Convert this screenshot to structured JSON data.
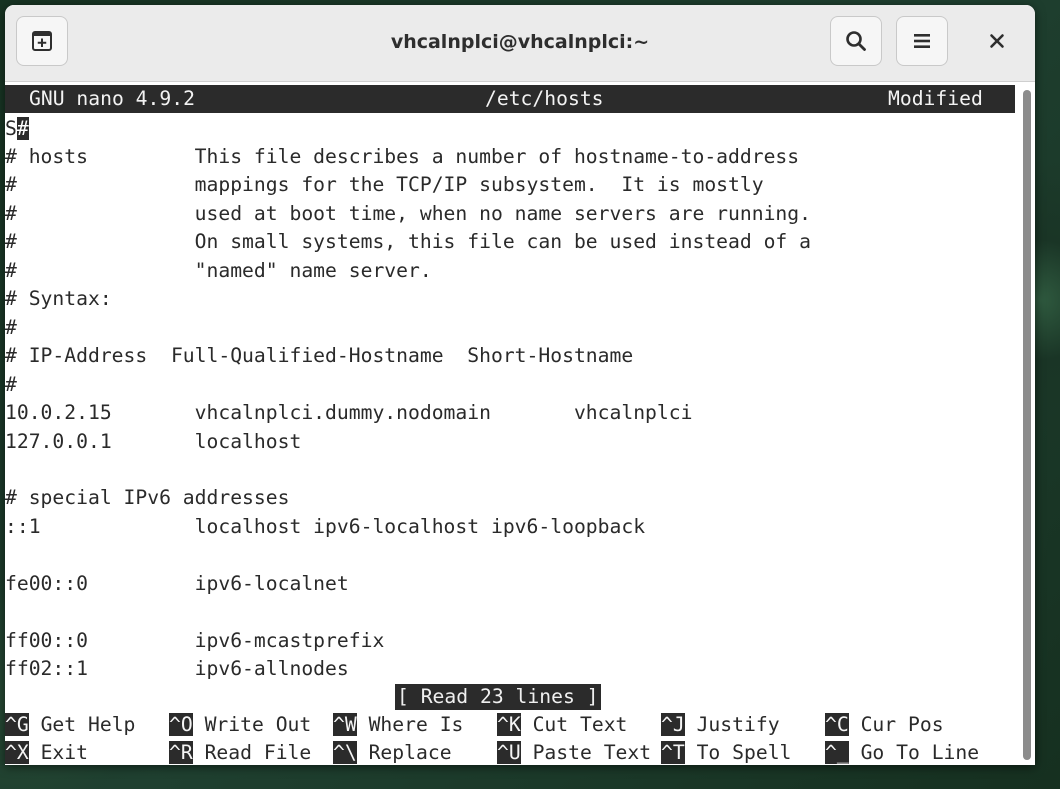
{
  "window": {
    "title": "vhcalnplci@vhcalnplci:~"
  },
  "icons": {
    "new_tab": "new-tab-icon",
    "search": "search-icon",
    "menu": "hamburger-menu-icon",
    "close": "close-icon"
  },
  "nano": {
    "header": {
      "app": "GNU nano 4.9.2",
      "filename": "/etc/hosts",
      "state": "Modified"
    },
    "cursor_line": {
      "prefix": "S",
      "cursor_char": "#"
    },
    "lines": [
      "# hosts         This file describes a number of hostname-to-address",
      "#               mappings for the TCP/IP subsystem.  It is mostly",
      "#               used at boot time, when no name servers are running.",
      "#               On small systems, this file can be used instead of a",
      "#               \"named\" name server.",
      "# Syntax:",
      "#",
      "# IP-Address  Full-Qualified-Hostname  Short-Hostname",
      "#",
      "10.0.2.15       vhcalnplci.dummy.nodomain       vhcalnplci",
      "127.0.0.1       localhost",
      "",
      "# special IPv6 addresses",
      "::1             localhost ipv6-localhost ipv6-loopback",
      "",
      "fe00::0         ipv6-localnet",
      "",
      "ff00::0         ipv6-mcastprefix",
      "ff02::1         ipv6-allnodes"
    ],
    "status": "[ Read 23 lines ]",
    "shortcuts_row1": [
      {
        "key": "^G",
        "label": " Get Help"
      },
      {
        "key": "^O",
        "label": " Write Out"
      },
      {
        "key": "^W",
        "label": " Where Is"
      },
      {
        "key": "^K",
        "label": " Cut Text"
      },
      {
        "key": "^J",
        "label": " Justify"
      },
      {
        "key": "^C",
        "label": " Cur Pos"
      }
    ],
    "shortcuts_row2": [
      {
        "key": "^X",
        "label": " Exit"
      },
      {
        "key": "^R",
        "label": " Read File"
      },
      {
        "key": "^\\",
        "label": " Replace"
      },
      {
        "key": "^U",
        "label": " Paste Text"
      },
      {
        "key": "^T",
        "label": " To Spell"
      },
      {
        "key": "^_",
        "label": " Go To Line"
      }
    ]
  },
  "colors": {
    "inverse_bg": "#2b2b2b",
    "inverse_fg": "#f3f3f3",
    "terminal_bg": "#ffffff",
    "terminal_fg": "#2a2a2a"
  }
}
